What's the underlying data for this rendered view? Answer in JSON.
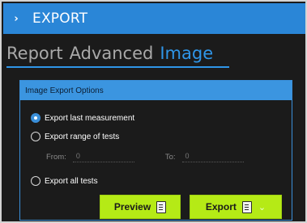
{
  "header": {
    "chevron": "›",
    "title": "EXPORT"
  },
  "tabs": [
    {
      "label": "Report",
      "active": false
    },
    {
      "label": "Advanced",
      "active": false
    },
    {
      "label": "Image",
      "active": true
    }
  ],
  "panel": {
    "title": "Image Export Options",
    "options": [
      {
        "label": "Export last measurement",
        "checked": true
      },
      {
        "label": "Export range of tests",
        "checked": false
      },
      {
        "label": "Export all tests",
        "checked": false
      }
    ],
    "range": {
      "from_label": "From:",
      "from_value": "0",
      "to_label": "To:",
      "to_value": "0"
    }
  },
  "buttons": {
    "preview_label": "Preview",
    "export_label": "Export",
    "preview_icon": "document-icon",
    "export_icon": "document-icon",
    "dropdown_icon": "chevron-down-icon"
  },
  "colors": {
    "accent": "#2a86d7",
    "panel_head": "#3b95e0",
    "button": "#b5ea16",
    "tab_active": "#2f96e8"
  }
}
